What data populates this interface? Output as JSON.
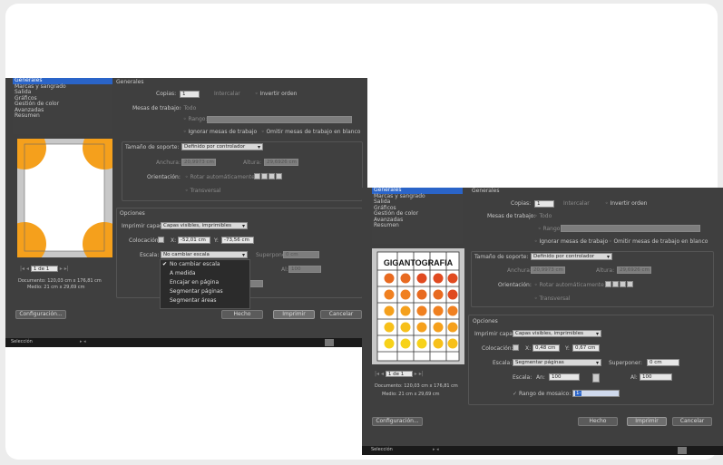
{
  "left": {
    "categories": [
      "Generales",
      "Marcas y sangrado",
      "Salida",
      "Gráficos",
      "Gestión de color",
      "Avanzadas",
      "Resumen"
    ],
    "section_title": "Generales",
    "copies_label": "Copias:",
    "copies_value": "1",
    "collate_label": "Intercalar",
    "reverse_label": "Invertir orden",
    "artboards_label": "Mesas de trabajo:",
    "all_label": "Todo",
    "range_label": "Rango:",
    "ignore_label": "Ignorar mesas de trabajo",
    "skip_blank_label": "Omitir mesas de trabajo en blanco",
    "media_size_label": "Tamaño de soporte:",
    "media_size_value": "Definido por controlador",
    "width_label": "Anchura:",
    "width_value": "20,9973 cm",
    "height_label": "Altura:",
    "height_value": "29,6926 cm",
    "orientation_label": "Orientación:",
    "auto_rotate_label": "Rotar automáticamente",
    "transverse_label": "Transversal",
    "options_title": "Opciones",
    "print_layers_label": "Imprimir capas:",
    "print_layers_value": "Capas visibles, imprimibles",
    "placement_label": "Colocación:",
    "x_label": "X:",
    "x_value": "-52,01 cm",
    "y_label": "Y:",
    "y_value": "-73,56 cm",
    "scale_label": "Escala:",
    "scale_value": "No cambiar escala",
    "overlap_label": "Superponer:",
    "overlap_value": "0 cm",
    "al_label": "Al:",
    "al_value": "100",
    "scale_menu": [
      "No cambiar escala",
      "A medida",
      "Encajar en página",
      "Segmentar páginas",
      "Segmentar áreas"
    ],
    "page_nav": "1 de 1",
    "document_info": "Documento: 120,03 cm x 176,81 cm",
    "media_info": "Medio: 21 cm x 29,69 cm",
    "config_button": "Configuración...",
    "done_button": "Hecho",
    "print_button": "Imprimir",
    "cancel_button": "Cancelar",
    "status_text": "Selección"
  },
  "right": {
    "categories": [
      "Generales",
      "Marcas y sangrado",
      "Salida",
      "Gráficos",
      "Gestión de color",
      "Avanzadas",
      "Resumen"
    ],
    "section_title": "Generales",
    "copies_label": "Copias:",
    "copies_value": "1",
    "collate_label": "Intercalar",
    "reverse_label": "Invertir orden",
    "artboards_label": "Mesas de trabajo:",
    "all_label": "Todo",
    "range_label": "Rango:",
    "ignore_label": "Ignorar mesas de trabajo",
    "skip_blank_label": "Omitir mesas de trabajo en blanco",
    "media_size_label": "Tamaño de soporte:",
    "media_size_value": "Definido por controlador",
    "width_label": "Anchura:",
    "width_value": "20,9973 cm",
    "height_label": "Altura:",
    "height_value": "29,6926 cm",
    "orientation_label": "Orientación:",
    "auto_rotate_label": "Rotar automáticamente",
    "transverse_label": "Transversal",
    "options_title": "Opciones",
    "print_layers_label": "Imprimir capas:",
    "print_layers_value": "Capas visibles, imprimibles",
    "placement_label": "Colocación:",
    "x_label": "X:",
    "x_value": "0,48 cm",
    "y_label": "Y:",
    "y_value": "0,67 cm",
    "scale_label": "Escala:",
    "scale_value": "Segmentar páginas",
    "overlap_label": "Superponer:",
    "overlap_value": "0 cm",
    "scale_sub_label": "Escala:",
    "an_label": "An:",
    "an_value": "100",
    "al_label": "Al:",
    "al_value": "100",
    "mosaic_label": "Rango de mosaico:",
    "mosaic_value": "1-",
    "preview_title": "GIGANTOGRAFIA",
    "page_nav": "1 de 1",
    "document_info": "Documento: 120,03 cm x 176,81 cm",
    "media_info": "Medio: 21 cm x 29,69 cm",
    "config_button": "Configuración...",
    "done_button": "Hecho",
    "print_button": "Imprimir",
    "cancel_button": "Cancelar",
    "status_text": "Selección"
  },
  "colors": {
    "dialog_bg": "#3f3f3f",
    "selection_blue": "#2a64c8",
    "orange": "#f5a01c",
    "red": "#e04a20",
    "yellow": "#f7d21a"
  }
}
